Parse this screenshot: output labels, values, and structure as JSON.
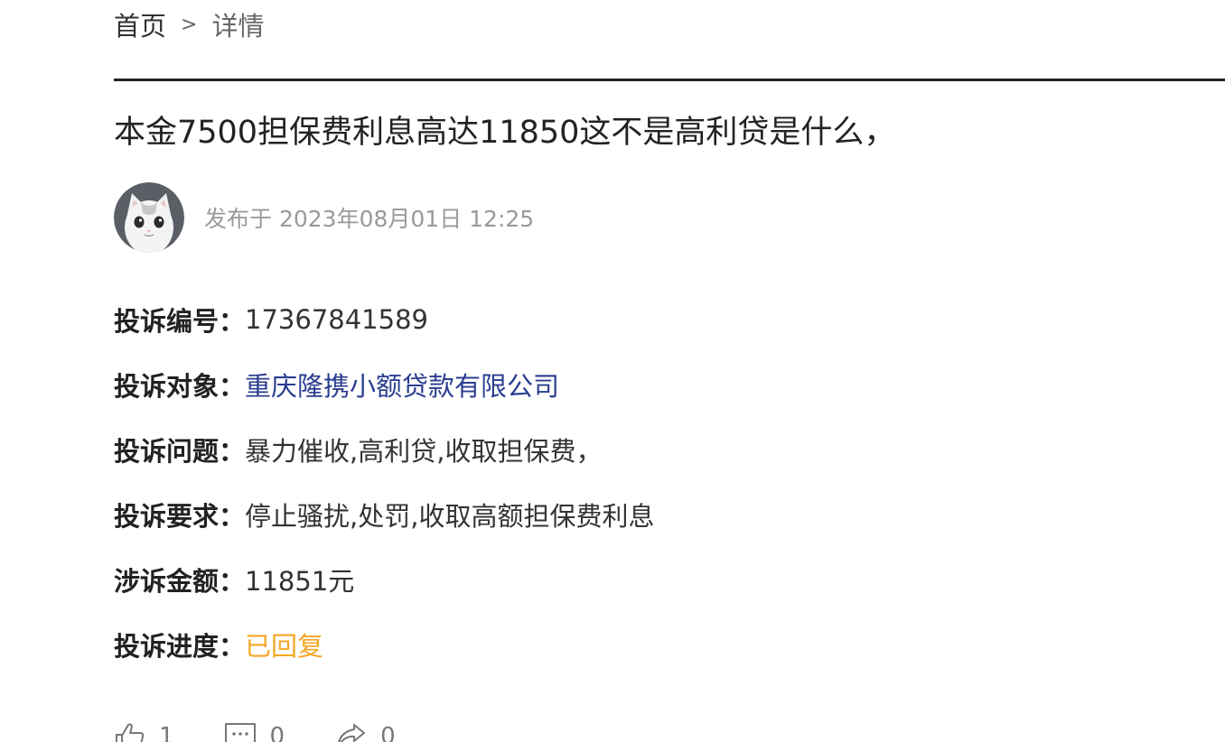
{
  "breadcrumb": {
    "home": "首页",
    "separator": ">",
    "current": "详情"
  },
  "title": "本金7500担保费利息高达11850这不是高利贷是什么，",
  "author": {
    "avatar_icon": "cat-avatar-icon",
    "publish_text": "发布于 2023年08月01日 12:25"
  },
  "fields": [
    {
      "label": "投诉编号：",
      "value": "17367841589",
      "style": "normal"
    },
    {
      "label": "投诉对象：",
      "value": "重庆隆携小额贷款有限公司",
      "style": "link"
    },
    {
      "label": "投诉问题：",
      "value": "暴力催收,高利贷,收取担保费，",
      "style": "normal"
    },
    {
      "label": "投诉要求：",
      "value": "停止骚扰,处罚,收取高额担保费利息",
      "style": "normal"
    },
    {
      "label": "涉诉金额：",
      "value": "11851元",
      "style": "normal"
    },
    {
      "label": "投诉进度：",
      "value": "已回复",
      "style": "status"
    }
  ],
  "actions": {
    "like": {
      "icon": "thumbs-up-icon",
      "count": "1"
    },
    "comment": {
      "icon": "comment-icon",
      "count": "0"
    },
    "share": {
      "icon": "share-icon",
      "count": "0"
    }
  },
  "colors": {
    "link": "#2a3d8f",
    "status": "#f5a623",
    "muted": "#9a9a9a"
  }
}
